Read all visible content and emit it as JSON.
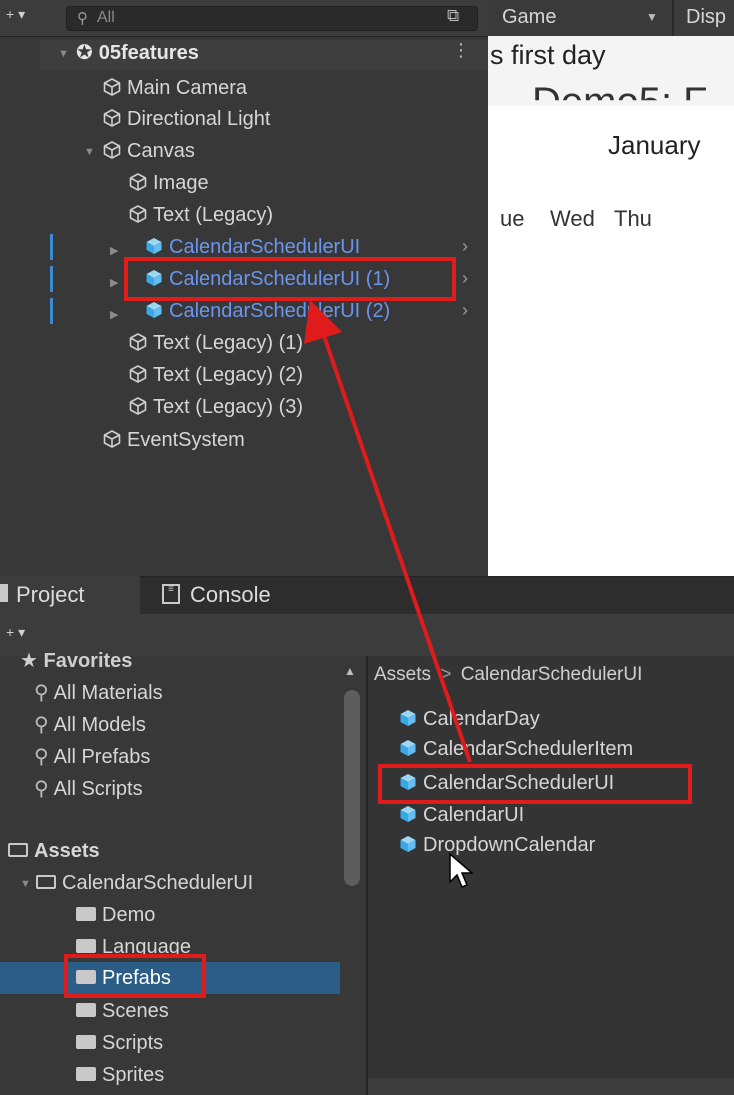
{
  "hierarchy": {
    "add_label": "+ ▾",
    "search_placeholder": "All",
    "scene": "05features",
    "items": [
      {
        "label": "Main Camera"
      },
      {
        "label": "Directional Light"
      },
      {
        "label": "Canvas"
      },
      {
        "label": "Image"
      },
      {
        "label": "Text (Legacy)"
      },
      {
        "label": "CalendarSchedulerUI"
      },
      {
        "label": "CalendarSchedulerUI (1)"
      },
      {
        "label": "CalendarSchedulerUI (2)"
      },
      {
        "label": "Text (Legacy) (1)"
      },
      {
        "label": "Text (Legacy) (2)"
      },
      {
        "label": "Text (Legacy) (3)"
      },
      {
        "label": "EventSystem"
      }
    ]
  },
  "game": {
    "tab_label": "Game",
    "display_label": "Disp",
    "line1": "s first day",
    "line2": "Demo5: F",
    "month": "January",
    "days": [
      "ue",
      "Wed",
      "Thu"
    ]
  },
  "project": {
    "tab_project": "Project",
    "tab_console": "Console",
    "toolbar_add": "+ ▾",
    "favorites_label": "Favorites",
    "favorites": [
      "All Materials",
      "All Models",
      "All Prefabs",
      "All Scripts"
    ],
    "assets_label": "Assets",
    "tree_root": "CalendarSchedulerUI",
    "tree_children": [
      "Demo",
      "Language",
      "Prefabs",
      "Scenes",
      "Scripts",
      "Sprites"
    ],
    "breadcrumb_root": "Assets",
    "breadcrumb_sep": ">",
    "breadcrumb_leaf": "CalendarSchedulerUI",
    "assets": [
      "CalendarDay",
      "CalendarSchedulerItem",
      "CalendarSchedulerUI",
      "CalendarUI",
      "DropdownCalendar"
    ]
  },
  "colors": {
    "highlight": "#e01b1b",
    "prefab_text": "#6b95ec",
    "selection": "#2c5d87"
  }
}
